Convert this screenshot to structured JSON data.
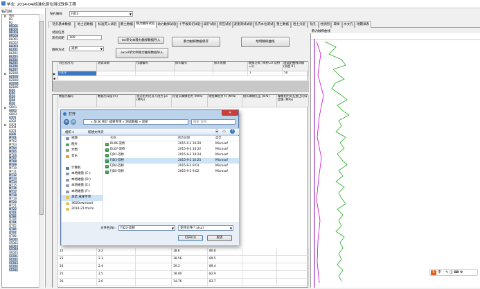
{
  "window": {
    "title": "毕业: 2014-04/标准化原位测试软件工程"
  },
  "tree": {
    "header": "钻孔树",
    "items": [
      {
        "label": "钻孔",
        "sel": false,
        "exp": true
      },
      {
        "label": "B1",
        "sel": false
      },
      {
        "label": "B2",
        "sel": false
      },
      {
        "label": "BFD01",
        "sel": true
      },
      {
        "label": "BFD02",
        "sel": true
      },
      {
        "label": "BFD03",
        "sel": true
      },
      {
        "label": "BFD04",
        "sel": true
      },
      {
        "label": "BLD01",
        "sel": false
      },
      {
        "label": "BLD02",
        "sel": false
      },
      {
        "label": "BLD03",
        "sel": true
      },
      {
        "label": "BLZ01",
        "sel": true
      },
      {
        "label": "BLZ02",
        "sel": false
      },
      {
        "label": "BLZ03",
        "sel": true
      },
      {
        "label": "BLZ04",
        "sel": true
      },
      {
        "label": "BLZ05",
        "sel": true
      },
      {
        "label": "BLZ06",
        "sel": true
      },
      {
        "label": "BLZ07",
        "sel": true
      },
      {
        "label": "BZD01",
        "sel": false,
        "exp": true
      },
      {
        "label": "BZD02",
        "sel": true
      },
      {
        "label": "BZD03",
        "sel": false
      },
      {
        "label": "BZD04",
        "sel": true
      },
      {
        "label": "BZD05",
        "sel": false
      },
      {
        "label": "FJD1",
        "sel": true
      },
      {
        "label": "FJD2",
        "sel": true
      },
      {
        "label": "FJD3",
        "sel": true
      },
      {
        "label": "FJD4",
        "sel": true
      },
      {
        "label": "FJD5",
        "sel": true
      },
      {
        "label": "GD01",
        "sel": false,
        "exp": true
      },
      {
        "label": "GD02",
        "sel": true
      },
      {
        "label": "GD03",
        "sel": false
      },
      {
        "label": "LD01",
        "sel": true
      },
      {
        "label": "LD02",
        "sel": false
      },
      {
        "label": "LD03",
        "sel": false,
        "exp": true
      },
      {
        "label": "LD04",
        "sel": false
      },
      {
        "label": "LD05",
        "sel": false
      },
      {
        "label": "LD06",
        "sel": true
      },
      {
        "label": "MT01",
        "sel": true
      },
      {
        "label": "MT02",
        "sel": false
      },
      {
        "label": "MT03",
        "sel": false
      },
      {
        "label": "MT04",
        "sel": true
      },
      {
        "label": "MT05",
        "sel": true
      },
      {
        "label": "MT06",
        "sel": false
      },
      {
        "label": "MT07",
        "sel": true
      },
      {
        "label": "MT08",
        "sel": true
      },
      {
        "label": "MT09",
        "sel": true
      },
      {
        "label": "MT10",
        "sel": false
      },
      {
        "label": "MT11",
        "sel": false
      },
      {
        "label": "MT12",
        "sel": true
      },
      {
        "label": "MT13",
        "sel": true
      },
      {
        "label": "MT14",
        "sel": true
      },
      {
        "label": "MT15",
        "sel": false
      },
      {
        "label": "MT16",
        "sel": true
      },
      {
        "label": "MT17",
        "sel": true
      },
      {
        "label": "MT18",
        "sel": true
      },
      {
        "label": "MT19",
        "sel": false
      },
      {
        "label": "MT20",
        "sel": true
      },
      {
        "label": "MT21",
        "sel": false
      },
      {
        "label": "MT22",
        "sel": true
      },
      {
        "label": "QT01",
        "sel": true
      },
      {
        "label": "QT02",
        "sel": true
      },
      {
        "label": "QT03",
        "sel": false
      },
      {
        "label": "QT04",
        "sel": true
      },
      {
        "label": "QT05",
        "sel": false
      },
      {
        "label": "QT06",
        "sel": true
      },
      {
        "label": "QT07",
        "sel": true
      },
      {
        "label": "QT08",
        "sel": false
      },
      {
        "label": "SFD01",
        "sel": true
      },
      {
        "label": "SFD02",
        "sel": false
      },
      {
        "label": "SFD03",
        "sel": true
      },
      {
        "label": "SFD04",
        "sel": true
      },
      {
        "label": "SFD05",
        "sel": false
      },
      {
        "label": "STZ01",
        "sel": true
      },
      {
        "label": "STZ02",
        "sel": true
      },
      {
        "label": "STZ03",
        "sel": true
      },
      {
        "label": "STZ04",
        "sel": true
      },
      {
        "label": "STZ05",
        "sel": true
      }
    ]
  },
  "top": {
    "drill_label": "钻孔编号",
    "drill_value": "FJD3"
  },
  "tabs": [
    "钻孔基本数据",
    "地土层数据",
    "标准贯入试验",
    "静土数据",
    "静力触探试验",
    "动力触探试验",
    "十字板剪切试验",
    "扁铲试验",
    "旁压试验",
    "波速测试试验",
    "孔内水位测试",
    "重土数据",
    "岩土分层",
    "钻孔",
    "柱状图",
    "取样",
    "水文孔",
    "地震详表"
  ],
  "active_tab": 4,
  "settings": {
    "title": "试验信息",
    "depth_label": "测点间距",
    "depth_value": "100",
    "mode_label": "静探方式",
    "mode_value": "双桥",
    "btn_txt": "txt单文本静力触探数据导入",
    "btn_excel": "excel单文件静力触探数据导入",
    "btn_save": "静力触探数据保存",
    "btn_draw": "绘制静探曲线"
  },
  "upper_grid": {
    "headers": [
      "对应钻孔号",
      "测试日期",
      "仪器编号",
      "探头编号",
      "探头系数",
      "静探方式 (单桥=0 双桥=1)",
      "测试距曲线间隔 (刻度 0 )"
    ],
    "row": [
      "FJD3",
      "",
      "",
      "",
      "",
      "1",
      "50"
    ]
  },
  "lower_grid": {
    "headers": [
      "数据点编号",
      "数据点深度(m)",
      "锥尖阻力比贯入阻力 ps (MPa)",
      "比锥头摩擦阻力 (MPa)",
      "侧壁摩阻力 fs (MPa)",
      "接头摩擦孔压 (kPa)",
      "摩擦阻力对应图上的深度值 (MPa)"
    ],
    "rows": [
      [
        "22",
        "2.2",
        "",
        "18.6",
        "80.6",
        "",
        ""
      ],
      [
        "23",
        "2.3",
        "",
        "18.56",
        "89.5",
        "",
        ""
      ],
      [
        "24",
        "2.4",
        "",
        "19.3",
        "89.4",
        "",
        ""
      ],
      [
        "25",
        "2.5",
        "",
        "18.00",
        "82.9",
        "",
        ""
      ],
      [
        "26",
        "2.6",
        "",
        "14.76",
        "83.7",
        "",
        ""
      ]
    ]
  },
  "chart": {
    "title": "静力触探曲线"
  },
  "dialog": {
    "title": "打开",
    "close": "✕",
    "path": "« 加 总 统计 成果专项 » 测试数据 » 双桥",
    "search_placeholder": "搜索 双桥",
    "organize": "组织 ▾",
    "new_folder": "新建文件夹",
    "nav": [
      {
        "label": "视频",
        "color": "#6a8fc7",
        "sel": false
      },
      {
        "label": "图片",
        "color": "#5aa06a",
        "sel": false
      },
      {
        "label": "文档",
        "color": "#9a9a9a",
        "sel": false
      },
      {
        "label": "音乐",
        "color": "#e0a030",
        "sel": false
      },
      {
        "label": "",
        "color": "",
        "sel": false
      },
      {
        "label": "计算机",
        "color": "#4a78b8",
        "sel": false
      },
      {
        "label": "本地磁盘 (C:)",
        "color": "#8a9ab0",
        "sel": false
      },
      {
        "label": "本地磁盘 (D:)",
        "color": "#8a9ab0",
        "sel": false
      },
      {
        "label": "本地磁盘 (E:)",
        "color": "#8a9ab0",
        "sel": false
      },
      {
        "label": "本地磁盘 (F:)",
        "color": "#8a9ab0",
        "sel": false
      },
      {
        "label": "总结 成果专项",
        "color": "#e8c060",
        "sel": true
      },
      {
        "label": "360Download",
        "color": "#e8c060",
        "sel": false
      },
      {
        "label": "2014-21 tmrm",
        "color": "#e8c060",
        "sel": false
      }
    ],
    "col_name": "名称",
    "col_date": "修改日期",
    "col_type": "类型",
    "files": [
      {
        "name": "DL06-双桥",
        "date": "2015-9-2 10:20",
        "type": "Microsof",
        "sel": false
      },
      {
        "name": "DL07-双桥",
        "date": "2015-9-2 10:22",
        "type": "Microsof",
        "sel": false
      },
      {
        "name": "FJD1-双桥",
        "date": "2015-9-2 10:24",
        "type": "Microsof",
        "sel": false
      },
      {
        "name": "FJD3-双桥",
        "date": "2015-9-2 10:25",
        "type": "Microsof",
        "sel": true
      },
      {
        "name": "FJD4-双桥",
        "date": "2015-9-2 9:01",
        "type": "Microsof",
        "sel": false
      },
      {
        "name": "FJD5-双桥",
        "date": "2015-9-2 9:02",
        "type": "Microsof",
        "sel": false
      }
    ],
    "filename_label": "文件名(N):",
    "filename_value": "FJD3-双桥",
    "type_value": "支持文件(*.xlsx)",
    "open": "打开(O)",
    "cancel": "取消"
  },
  "ime": {
    "logo": "S",
    "label": "中 ◦ ✎ ◫ ⌨ ⚙"
  }
}
